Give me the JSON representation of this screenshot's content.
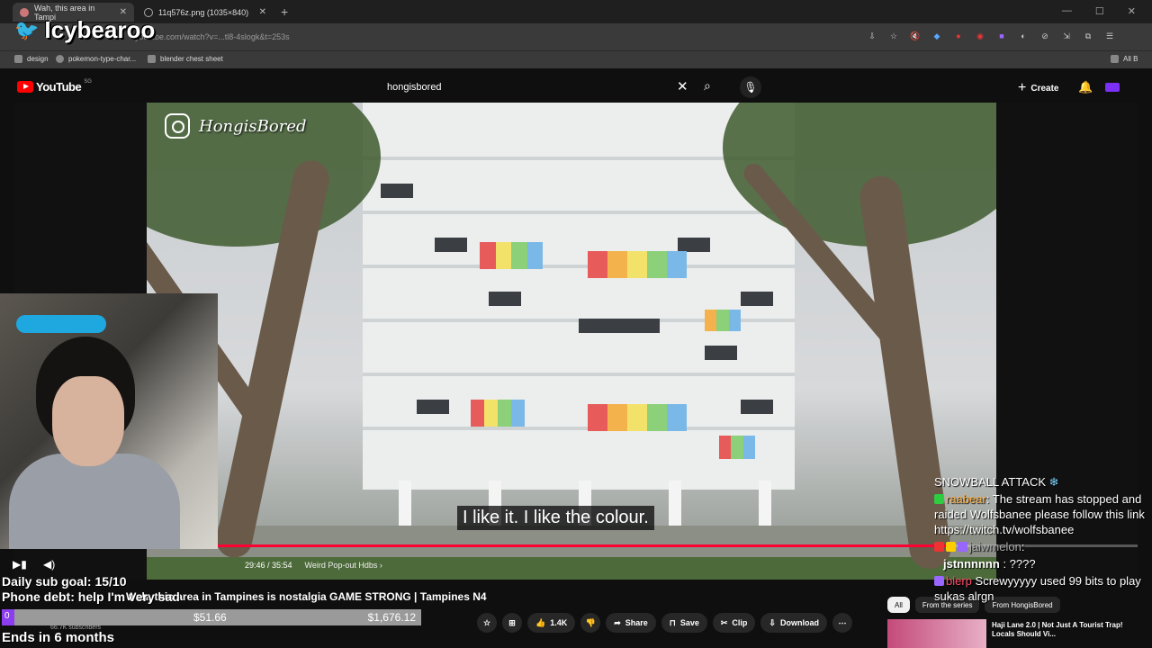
{
  "browser": {
    "tabs": [
      {
        "title": "Wah, this area in Tampi",
        "active": true
      },
      {
        "title": "11q576z.png (1035×840)",
        "active": false
      }
    ],
    "new_tab": "+",
    "url": "youtube.com/watch?v=...tl8-4slogk&t=253s",
    "bookmarks": [
      "design",
      "pokemon-type-char...",
      "blender chest sheet"
    ],
    "bookmarks_right": "All B"
  },
  "streamer": {
    "name": "Icybearoo"
  },
  "youtube": {
    "logo": "YouTube",
    "country": "SG",
    "search_value": "hongisbored",
    "create_label": "Create"
  },
  "video": {
    "watermark": "HongisBored",
    "subtitle": "I like it. I like the colour.",
    "time": "29:46 / 35:54",
    "chapter": "Weird Pop-out Hdbs",
    "progress": 0.829,
    "title": "Wah, this area in Tampines is nostalgia GAME STRONG | Tampines N4",
    "subscribers": "66.7K subscribers"
  },
  "actions": {
    "like_count": "1.4K",
    "share": "Share",
    "save": "Save",
    "clip": "Clip",
    "download": "Download"
  },
  "recommendations": {
    "filters": [
      "All",
      "From the series",
      "From HongisBored"
    ],
    "title": "Haji Lane 2.0 | Not Just A Tourist Trap! Locals Should Vi..."
  },
  "overlay": {
    "sub_goal": "Daily sub goal: 15/10",
    "phone_debt": "Phone debt: help I'm very sad",
    "goal_zero": "0",
    "goal_current": "$51.66",
    "goal_target": "$1,676.12",
    "goal_fraction": 0.031,
    "ends": "Ends in 6 months"
  },
  "chat": {
    "event": "SNOWBALL ATTACK",
    "messages": [
      {
        "user": "raabear",
        "text": "The stream has stopped and raided Wolfsbanee please follow this link https://twitch.tv/wolfsbanee"
      },
      {
        "user": "jaiwmelon",
        "text": ""
      },
      {
        "user": "jstnnnnnn",
        "text": "????"
      },
      {
        "user": "blerp",
        "text": "Screwyyyyy used 99 bits to play sukas alrgn"
      }
    ]
  },
  "colors": {
    "youtube_red": "#ff0000",
    "progress": "#ff0033",
    "goal_fill": "#8c3df0",
    "twitter_blue": "#1da1f2"
  }
}
